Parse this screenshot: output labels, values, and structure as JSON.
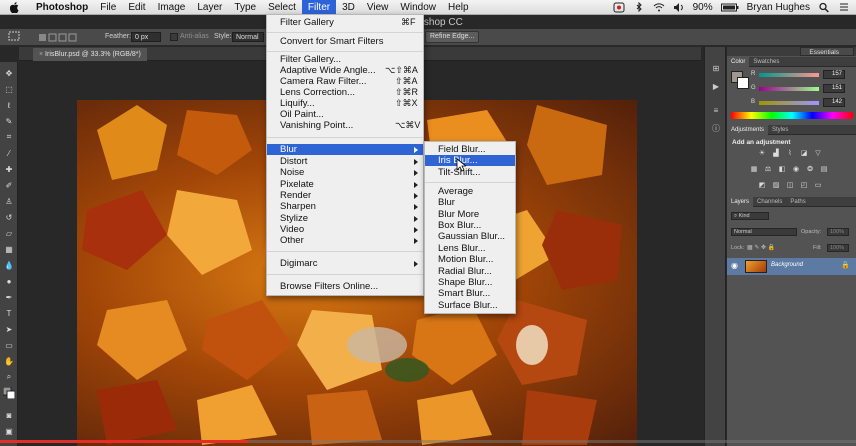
{
  "menubar": {
    "app_name": "Photoshop",
    "items": [
      "File",
      "Edit",
      "Image",
      "Layer",
      "Type",
      "Select",
      "Filter",
      "3D",
      "View",
      "Window",
      "Help"
    ],
    "active_item": "Filter",
    "battery": "90%",
    "user": "Bryan Hughes"
  },
  "window": {
    "title_fragment": "otoshop CC"
  },
  "options": {
    "feather_label": "Feather:",
    "feather_value": "0 px",
    "antialias_label": "Anti-alias",
    "style_label": "Style:",
    "style_value": "Normal",
    "refine_label": "Refine Edge..."
  },
  "document": {
    "tab_label": "IrisBlur.psd @ 33.3% (RGB/8*)"
  },
  "workspace": {
    "label": "Essentials"
  },
  "filter_menu": {
    "items": [
      {
        "label": "Filter Gallery",
        "shortcut": "⌘F"
      },
      {
        "label": "Convert for Smart Filters",
        "shortcut": ""
      },
      {
        "label": "Filter Gallery...",
        "shortcut": ""
      },
      {
        "label": "Adaptive Wide Angle...",
        "shortcut": "⌥⇧⌘A"
      },
      {
        "label": "Camera Raw Filter...",
        "shortcut": "⇧⌘A"
      },
      {
        "label": "Lens Correction...",
        "shortcut": "⇧⌘R"
      },
      {
        "label": "Liquify...",
        "shortcut": "⇧⌘X"
      },
      {
        "label": "Oil Paint...",
        "shortcut": ""
      },
      {
        "label": "Vanishing Point...",
        "shortcut": "⌥⌘V"
      },
      {
        "label": "Blur",
        "shortcut": ""
      },
      {
        "label": "Distort",
        "shortcut": ""
      },
      {
        "label": "Noise",
        "shortcut": ""
      },
      {
        "label": "Pixelate",
        "shortcut": ""
      },
      {
        "label": "Render",
        "shortcut": ""
      },
      {
        "label": "Sharpen",
        "shortcut": ""
      },
      {
        "label": "Stylize",
        "shortcut": ""
      },
      {
        "label": "Video",
        "shortcut": ""
      },
      {
        "label": "Other",
        "shortcut": ""
      },
      {
        "label": "Digimarc",
        "shortcut": ""
      },
      {
        "label": "Browse Filters Online...",
        "shortcut": ""
      }
    ]
  },
  "blur_submenu": {
    "items": [
      "Field Blur...",
      "Iris Blur...",
      "Tilt-Shift...",
      "Average",
      "Blur",
      "Blur More",
      "Box Blur...",
      "Gaussian Blur...",
      "Lens Blur...",
      "Motion Blur...",
      "Radial Blur...",
      "Shape Blur...",
      "Smart Blur...",
      "Surface Blur..."
    ]
  },
  "color_panel": {
    "tabs": [
      "Color",
      "Swatches"
    ],
    "r_label": "R",
    "g_label": "G",
    "b_label": "B",
    "r_value": "157",
    "g_value": "151",
    "b_value": "142"
  },
  "adjustments_panel": {
    "tabs": [
      "Adjustments",
      "Styles"
    ],
    "add_label": "Add an adjustment"
  },
  "layers_panel": {
    "tabs": [
      "Layers",
      "Channels",
      "Paths"
    ],
    "kind_label": "Kind",
    "blend_mode": "Normal",
    "opacity_label": "Opacity:",
    "opacity_value": "100%",
    "lock_label": "Lock:",
    "fill_label": "Fill:",
    "fill_value": "100%",
    "layer_name": "Background"
  },
  "video": {
    "progress_fraction": 0.29
  },
  "colors": {
    "accent": "#2e64d4",
    "progress": "#e52d27"
  }
}
